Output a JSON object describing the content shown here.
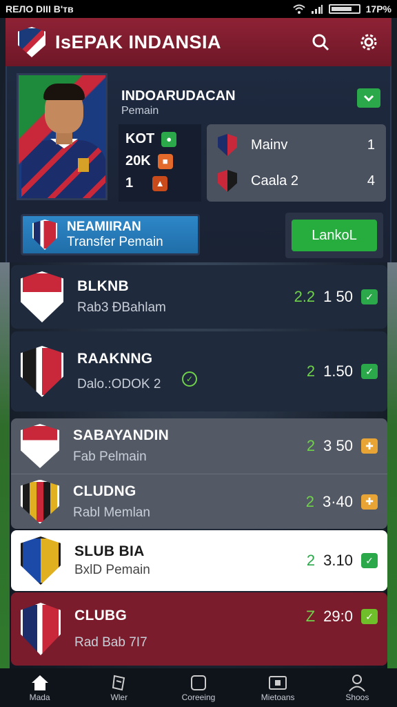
{
  "status_bar": {
    "left": "REЛO DIII B'тв",
    "battery": "17P%"
  },
  "header": {
    "title": "IsEPAK INDANSIA"
  },
  "player": {
    "name": "INDOARUDACAN",
    "role": "Pemain",
    "stats": [
      {
        "value": "KOT",
        "icon": "leaf-icon",
        "color": "#2aa84a"
      },
      {
        "value": "20K",
        "icon": "gift-icon",
        "color": "#e36a2a"
      },
      {
        "value": "1",
        "icon": "fire-icon",
        "color": "#c94a1a"
      }
    ],
    "matches": [
      {
        "label": "Mainv",
        "value": "1"
      },
      {
        "label": "Caala 2",
        "value": "4"
      }
    ]
  },
  "transfer": {
    "line1": "NEAMIIRAN",
    "line2": "Transfer Pemain"
  },
  "lanjut": {
    "label": "LankoL"
  },
  "clubs": [
    {
      "name": "BLKNB",
      "sub": "Rab3 ĐBahlam",
      "rank": "2.2",
      "value": "1 50",
      "badge_color": "#2aa84a",
      "style": "r-dark"
    },
    {
      "name": "RAAKNNG",
      "sub": "Dalo.:ODOK 2",
      "rank": "2",
      "value": "1.50",
      "badge_color": "#2aa84a",
      "style": "r-dark"
    },
    {
      "name": "SABAYANDIN",
      "sub": "Fab Pelmain",
      "rank": "2",
      "value": "3 50",
      "badge_color": "#e8a434",
      "style": "r-gray"
    },
    {
      "name": "CLUDNG",
      "sub": "Rabl Memlan",
      "rank": "2",
      "value": "3·40",
      "badge_color": "#e8a434",
      "style": "r-gray"
    },
    {
      "name": "SLUB BIA",
      "sub": "BxlD Pemain",
      "rank": "2",
      "value": "3.10",
      "badge_color": "#2aa84a",
      "style": "r-white"
    },
    {
      "name": "CLUBG",
      "sub": "Rad Bab 7I7",
      "rank": "Z",
      "value": "29:0",
      "badge_color": "#6fbf2a",
      "style": "r-red"
    }
  ],
  "nav": [
    {
      "label": "Mada",
      "icon": "home-icon"
    },
    {
      "label": "Wler",
      "icon": "scroll-icon"
    },
    {
      "label": "Coreeing",
      "icon": "square-icon"
    },
    {
      "label": "Mietoans",
      "icon": "ticket-icon"
    },
    {
      "label": "Shoos",
      "icon": "user-icon"
    }
  ]
}
